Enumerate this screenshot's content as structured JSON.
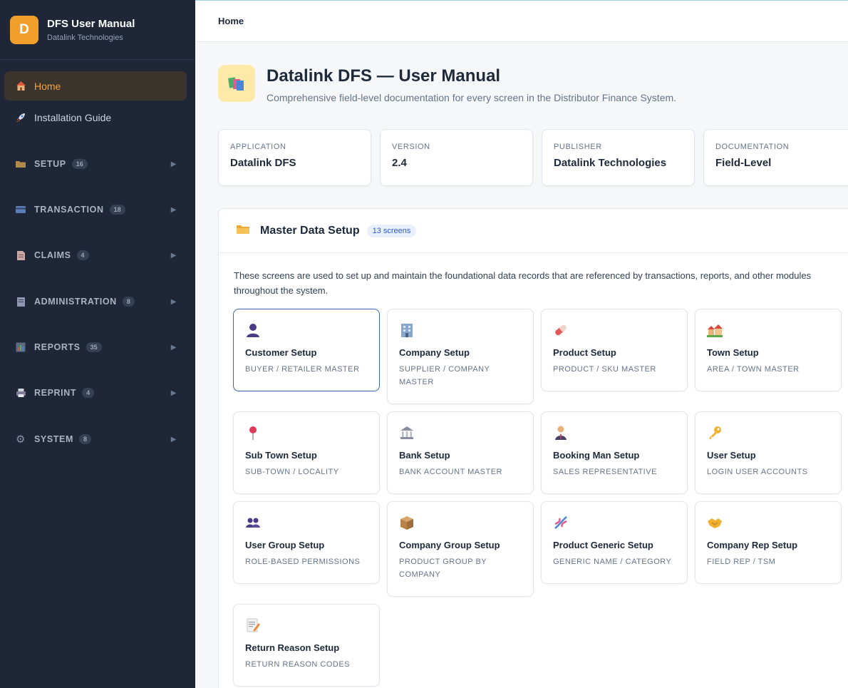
{
  "sidebar": {
    "brand": {
      "logo_letter": "D",
      "title": "DFS User Manual",
      "subtitle": "Datalink Technologies"
    },
    "nav": [
      {
        "label": "Home",
        "icon": "house-icon",
        "active": true
      },
      {
        "label": "Installation Guide",
        "icon": "rocket-icon",
        "active": false
      }
    ],
    "sections": [
      {
        "label": "SETUP",
        "count": "16",
        "icon": "folder-icon"
      },
      {
        "label": "TRANSACTION",
        "count": "18",
        "icon": "credit-card-icon"
      },
      {
        "label": "CLAIMS",
        "count": "4",
        "icon": "document-icon"
      },
      {
        "label": "ADMINISTRATION",
        "count": "8",
        "icon": "notebook-icon"
      },
      {
        "label": "REPORTS",
        "count": "35",
        "icon": "bar-chart-icon"
      },
      {
        "label": "REPRINT",
        "count": "4",
        "icon": "printer-icon"
      },
      {
        "label": "SYSTEM",
        "count": "8",
        "icon": "gear-icon"
      }
    ]
  },
  "topbar": {
    "breadcrumb": "Home"
  },
  "header": {
    "icon": "books-icon",
    "title": "Datalink DFS — User Manual",
    "subtitle": "Comprehensive field-level documentation for every screen in the Distributor Finance System."
  },
  "info_cards": [
    {
      "label": "APPLICATION",
      "value": "Datalink DFS"
    },
    {
      "label": "VERSION",
      "value": "2.4"
    },
    {
      "label": "PUBLISHER",
      "value": "Datalink Technologies"
    },
    {
      "label": "DOCUMENTATION",
      "value": "Field-Level"
    }
  ],
  "section": {
    "icon": "folder-icon",
    "title": "Master Data Setup",
    "badge": "13 screens",
    "description": "These screens are used to set up and maintain the foundational data records that are referenced by transactions, reports, and other modules throughout the system.",
    "cards": [
      {
        "title": "Customer Setup",
        "subtitle": "BUYER / RETAILER MASTER",
        "icon": "person-icon",
        "selected": true
      },
      {
        "title": "Company Setup",
        "subtitle": "SUPPLIER / COMPANY MASTER",
        "icon": "office-building-icon"
      },
      {
        "title": "Product Setup",
        "subtitle": "PRODUCT / SKU MASTER",
        "icon": "pill-icon"
      },
      {
        "title": "Town Setup",
        "subtitle": "AREA / TOWN MASTER",
        "icon": "houses-icon"
      },
      {
        "title": "Sub Town Setup",
        "subtitle": "SUB-TOWN / LOCALITY",
        "icon": "pushpin-icon"
      },
      {
        "title": "Bank Setup",
        "subtitle": "BANK ACCOUNT MASTER",
        "icon": "bank-icon"
      },
      {
        "title": "Booking Man Setup",
        "subtitle": "SALES REPRESENTATIVE",
        "icon": "businessman-icon"
      },
      {
        "title": "User Setup",
        "subtitle": "LOGIN USER ACCOUNTS",
        "icon": "key-icon"
      },
      {
        "title": "User Group Setup",
        "subtitle": "ROLE-BASED PERMISSIONS",
        "icon": "people-icon"
      },
      {
        "title": "Company Group Setup",
        "subtitle": "PRODUCT GROUP BY COMPANY",
        "icon": "package-icon"
      },
      {
        "title": "Product Generic Setup",
        "subtitle": "GENERIC NAME / CATEGORY",
        "icon": "dna-icon"
      },
      {
        "title": "Company Rep Setup",
        "subtitle": "FIELD REP / TSM",
        "icon": "handshake-icon"
      },
      {
        "title": "Return Reason Setup",
        "subtitle": "RETURN REASON CODES",
        "icon": "memo-icon"
      }
    ]
  }
}
